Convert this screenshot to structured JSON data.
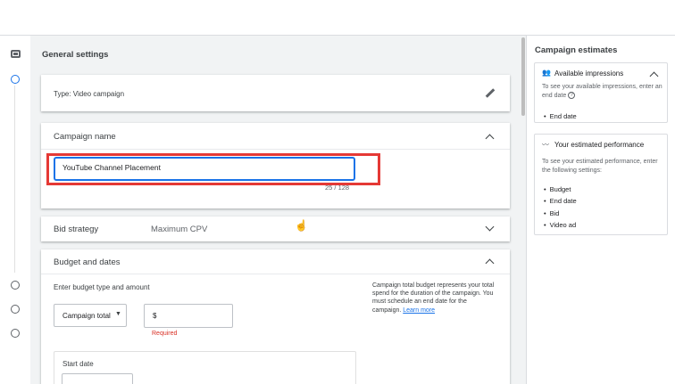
{
  "general_settings": {
    "title": "General settings"
  },
  "type_card": {
    "label": "Type: Video campaign"
  },
  "campaign_name": {
    "title": "Campaign name",
    "value": "YouTube Channel Placement",
    "char_count": "25 / 128"
  },
  "bid_strategy": {
    "label": "Bid strategy",
    "value": "Maximum CPV"
  },
  "budget": {
    "title": "Budget and dates",
    "prompt": "Enter budget type and amount",
    "type_select": "Campaign total",
    "currency": "$",
    "required": "Required",
    "help": "Campaign total budget represents your total spend for the duration of the campaign. You must schedule an end date for the campaign.",
    "learn_more": "Learn more",
    "start_date": "Start date"
  },
  "estimates": {
    "title": "Campaign estimates",
    "impressions": {
      "title": "Available impressions",
      "text": "To see your available impressions, enter an end date",
      "items": [
        "End date"
      ]
    },
    "performance": {
      "title": "Your estimated performance",
      "text": "To see your estimated performance, enter the following settings:",
      "items": [
        "Budget",
        "End date",
        "Bid",
        "Video ad"
      ]
    }
  },
  "colors": {
    "accent": "#1a73e8",
    "highlight": "#e53935",
    "required": "#d93025"
  }
}
